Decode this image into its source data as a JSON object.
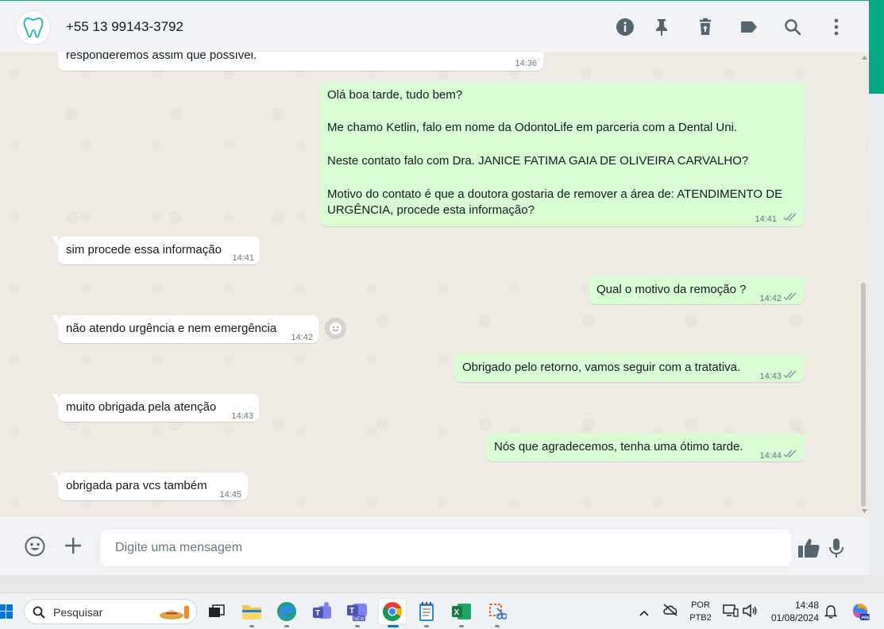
{
  "header": {
    "contact_name": "+55 13 99143-3792",
    "icons": [
      "info-icon",
      "pin-icon",
      "delete-icon",
      "label-icon",
      "search-icon",
      "menu-icon"
    ]
  },
  "messages": [
    {
      "direction": "in",
      "lines": [
        "responderemos assim que possível."
      ],
      "time": "14:36"
    },
    {
      "direction": "out",
      "lines": [
        "Olá boa tarde, tudo bem?",
        "",
        "Me chamo Ketlin, falo em nome da OdontoLife em parceria com a Dental Uni.",
        "",
        "Neste contato falo com Dra. JANICE FATIMA GAIA DE OLIVEIRA CARVALHO?",
        "",
        "Motivo do contato é que a doutora gostaria de remover a área de: ATENDIMENTO DE",
        "URGÊNCIA, procede esta informação?"
      ],
      "time": "14:41"
    },
    {
      "direction": "in",
      "lines": [
        "sim procede essa informação"
      ],
      "time": "14:41"
    },
    {
      "direction": "out",
      "lines": [
        "Qual o motivo da remoção ?"
      ],
      "time": "14:42"
    },
    {
      "direction": "in",
      "lines": [
        "não atendo urgência e nem emergência"
      ],
      "time": "14:42"
    },
    {
      "direction": "out",
      "lines": [
        "Obrigado pelo retorno, vamos seguir com a tratativa."
      ],
      "time": "14:43"
    },
    {
      "direction": "in",
      "lines": [
        "muito obrigada pela atenção"
      ],
      "time": "14:43"
    },
    {
      "direction": "out",
      "lines": [
        "Nós que agradecemos, tenha uma ótimo tarde."
      ],
      "time": "14:44"
    },
    {
      "direction": "in",
      "lines": [
        "obrigada para vcs também"
      ],
      "time": "14:45"
    }
  ],
  "composer": {
    "placeholder": "Digite uma mensagem"
  },
  "taskbar": {
    "search_label": "Pesquisar",
    "language": "POR",
    "layout": "PTB2",
    "time": "14:48",
    "date": "01/08/2024"
  },
  "colors": {
    "accent": "#00a884",
    "outgoing_bubble": "#d9fdd3",
    "incoming_bubble": "#ffffff",
    "chat_bg": "#efeae2",
    "header_bg": "#f0f2f5"
  }
}
